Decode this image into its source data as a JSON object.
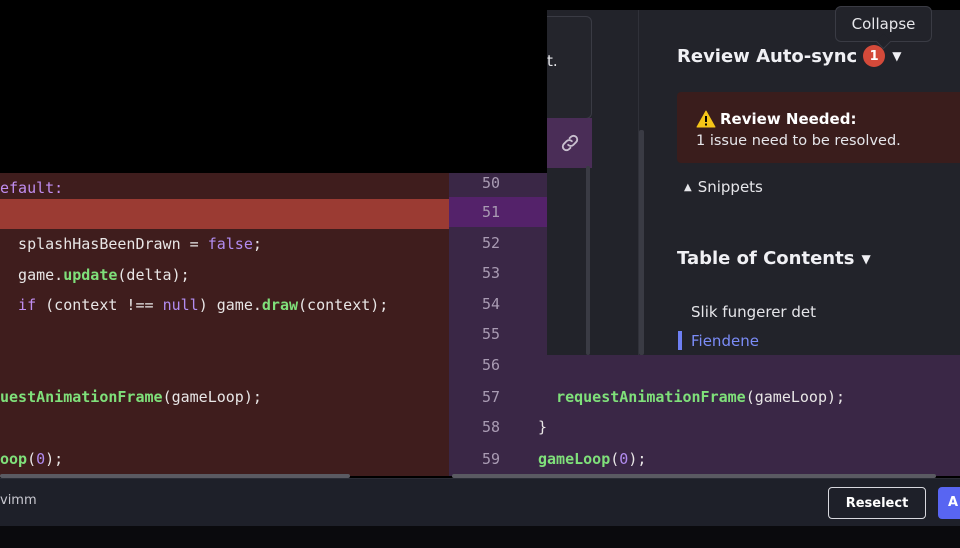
{
  "left_pane": {
    "lines": [
      {
        "code": "efault:",
        "highlight": false
      },
      {
        "code": "",
        "highlight": true
      },
      {
        "pre": "  splashHasBeenDrawn = ",
        "lit": "false",
        "post": ";",
        "highlight": false
      },
      {
        "pre": "  game.",
        "fn": "update",
        "post": "(delta);",
        "highlight": false
      },
      {
        "kw": "  if",
        "pre": " (context !== ",
        "lit": "null",
        "post": ") game.",
        "fn": "draw",
        "post2": "(context);",
        "highlight": false
      },
      {
        "code": "",
        "highlight": false
      },
      {
        "code": "",
        "highlight": false
      },
      {
        "fn": "uestAnimationFrame",
        "post": "(gameLoop);",
        "highlight": false
      },
      {
        "code": "",
        "highlight": false
      },
      {
        "fn": "oop",
        "pre2": "(",
        "lit": "0",
        "post": ");",
        "highlight": false
      }
    ]
  },
  "right_pane": {
    "lines": [
      {
        "num": "50",
        "highlight": false
      },
      {
        "num": "51",
        "highlight": true
      },
      {
        "num": "52",
        "highlight": false
      },
      {
        "num": "53",
        "highlight": false
      },
      {
        "num": "54",
        "highlight": false
      },
      {
        "num": "55",
        "highlight": false
      },
      {
        "num": "56",
        "highlight": false
      },
      {
        "num": "57",
        "indent": "  ",
        "fn": "requestAnimationFrame",
        "post": "(gameLoop);",
        "highlight": false
      },
      {
        "num": "58",
        "text": "}",
        "highlight": false
      },
      {
        "num": "59",
        "fn": "gameLoop",
        "pre2": "(",
        "lit": "0",
        "post": ");",
        "highlight": false
      }
    ]
  },
  "bottom_bar": {
    "label": "vimm",
    "reselect_label": "Reselect",
    "accept_label": "A"
  },
  "panel": {
    "popup_text": "t.",
    "collapse_label": "Collapse",
    "review_title": "Review Auto-sync",
    "review_badge": "1",
    "review_box_title": "Review Needed:",
    "review_box_text": "1 issue need to be resolved.",
    "snippets_label": "Snippets",
    "toc_title": "Table of Contents",
    "toc_items": [
      "Slik fungerer det",
      "Fiendene"
    ]
  },
  "colors": {
    "left_bg": "#3f1d1d",
    "left_highlight": "#9b3b33",
    "right_bg": "#3a2746",
    "right_highlight": "#54226a",
    "accent": "#5865f2",
    "badge": "#d44a3a",
    "toc_active": "#7b8cf7"
  },
  "icons": {
    "link": "link-icon",
    "warning": "warning-icon",
    "caret": "caret-down-icon"
  }
}
